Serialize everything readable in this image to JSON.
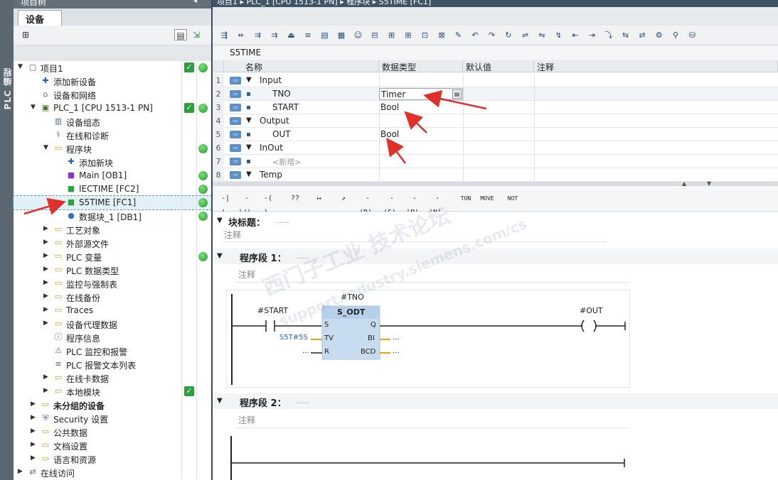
{
  "left_panel": {
    "side_label": "PLC 编程",
    "top_title": "项目树",
    "tab_label": "设备",
    "tree": [
      {
        "label": "项目1",
        "level": 0,
        "check": true,
        "dot": true,
        "bold": false,
        "icon": "project-icon"
      },
      {
        "label": "添加新设备",
        "level": 1,
        "icon": "add-device-icon"
      },
      {
        "label": "设备和网络",
        "level": 1,
        "icon": "network-icon"
      },
      {
        "label": "PLC_1 [CPU 1513-1 PN]",
        "level": 1,
        "check": true,
        "dot": true,
        "icon": "cpu-icon"
      },
      {
        "label": "设备组态",
        "level": 2,
        "icon": "device-config-icon"
      },
      {
        "label": "在线和诊断",
        "level": 2,
        "icon": "diagnostics-icon"
      },
      {
        "label": "程序块",
        "level": 2,
        "dot": true,
        "icon": "folder-icon"
      },
      {
        "label": "添加新块",
        "level": 3,
        "icon": "add-block-icon"
      },
      {
        "label": "Main [OB1]",
        "level": 3,
        "dot": true,
        "icon": "ob-icon"
      },
      {
        "label": "IECTIME [FC2]",
        "level": 3,
        "dot": true,
        "icon": "fc-icon"
      },
      {
        "label": "S5TIME [FC1]",
        "level": 3,
        "dot": true,
        "icon": "fc-icon",
        "selected": true
      },
      {
        "label": "数据块_1 [DB1]",
        "level": 3,
        "dot": true,
        "icon": "db-icon"
      },
      {
        "label": "工艺对象",
        "level": 2,
        "icon": "folder-icon"
      },
      {
        "label": "外部源文件",
        "level": 2,
        "icon": "folder-icon"
      },
      {
        "label": "PLC 变量",
        "level": 2,
        "dot": true,
        "icon": "folder-icon"
      },
      {
        "label": "PLC 数据类型",
        "level": 2,
        "icon": "folder-icon"
      },
      {
        "label": "监控与强制表",
        "level": 2,
        "icon": "folder-icon"
      },
      {
        "label": "在线备份",
        "level": 2,
        "icon": "folder-icon"
      },
      {
        "label": "Traces",
        "level": 2,
        "icon": "folder-icon"
      },
      {
        "label": "设备代理数据",
        "level": 2,
        "icon": "folder-icon"
      },
      {
        "label": "程序信息",
        "level": 2,
        "icon": "info-icon"
      },
      {
        "label": "PLC 监控和报警",
        "level": 2,
        "icon": "alarm-icon"
      },
      {
        "label": "PLC 报警文本列表",
        "level": 2,
        "icon": "text-list-icon"
      },
      {
        "label": "在线卡数据",
        "level": 2,
        "icon": "folder-icon"
      },
      {
        "label": "本地模块",
        "level": 2,
        "check": true,
        "icon": "folder-icon"
      },
      {
        "label": "未分组的设备",
        "level": 1,
        "bold": true,
        "icon": "folder-icon"
      },
      {
        "label": "Security 设置",
        "level": 1,
        "icon": "security-icon"
      },
      {
        "label": "公共数据",
        "level": 1,
        "icon": "folder-icon"
      },
      {
        "label": "文档设置",
        "level": 1,
        "icon": "folder-icon"
      },
      {
        "label": "语言和资源",
        "level": 1,
        "icon": "folder-icon"
      },
      {
        "label": "在线访问",
        "level": 0,
        "icon": "online-icon"
      }
    ]
  },
  "editor": {
    "breadcrumb": "项目1 ▸ PLC_1 [CPU 1513-1 PN] ▸ 程序块 ▸ S5TIME [FC1]",
    "block_name": "S5TIME",
    "interface_headers": [
      "名称",
      "数据类型",
      "默认值",
      "注释"
    ],
    "interface_rows": [
      {
        "num": "1",
        "name": "Input",
        "type": "",
        "section": true
      },
      {
        "num": "2",
        "name": "TNO",
        "type": "Timer",
        "section": false
      },
      {
        "num": "3",
        "name": "START",
        "type": "Bool",
        "section": false
      },
      {
        "num": "4",
        "name": "Output",
        "type": "",
        "section": true
      },
      {
        "num": "5",
        "name": "OUT",
        "type": "Bool",
        "section": false
      },
      {
        "num": "6",
        "name": "InOut",
        "type": "",
        "section": true
      },
      {
        "num": "7",
        "name": "<新增>",
        "type": "",
        "section": false,
        "placeholder": true
      },
      {
        "num": "8",
        "name": "Temp",
        "type": "",
        "section": true
      }
    ],
    "ladder_buttons": [
      "-| |-",
      "-|/|-",
      "-( )-",
      "??",
      "↦",
      "↗",
      "-(R)-",
      "-(S)-",
      "-|P|-",
      "-|N|-",
      "TON",
      "MOVE",
      "NOT"
    ],
    "block_title_label": "块标题：",
    "block_title_dots": ".....",
    "comment_label": "注释",
    "network1": {
      "title": "程序段 1：",
      "dots": ".....",
      "comment": "注释",
      "timer_operand": "#TNO",
      "box_type": "S_ODT",
      "contact_label": "#START",
      "coil_label": "#OUT",
      "pins_left": [
        "S",
        "TV",
        "R"
      ],
      "pins_right": [
        "Q",
        "BI",
        "BCD"
      ],
      "tv_value": "S5T#5S",
      "r_value": "...",
      "bi_value": "...",
      "bcd_value": "..."
    },
    "network2": {
      "title": "程序段 2：",
      "dots": ".....",
      "comment": "注释"
    },
    "watermark": [
      "西门子工业  技术论坛",
      "support.industry.siemens.com/cs"
    ]
  }
}
